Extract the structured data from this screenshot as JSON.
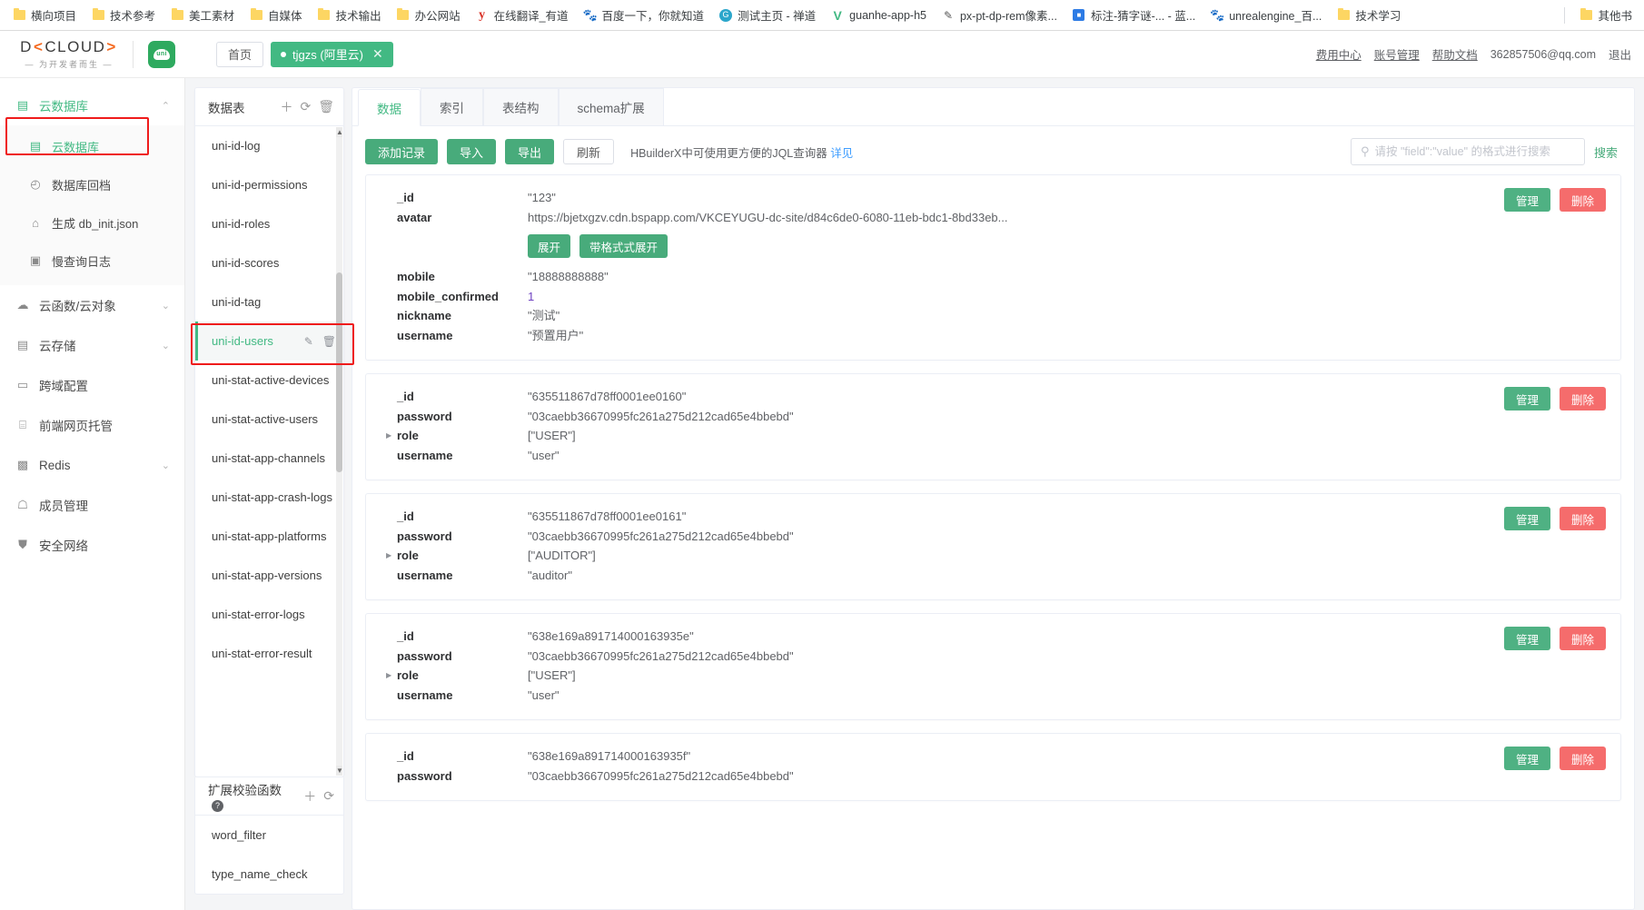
{
  "browser": {
    "bookmarks": [
      {
        "label": "横向项目",
        "icon": "folder-icon"
      },
      {
        "label": "技术参考",
        "icon": "folder-icon"
      },
      {
        "label": "美工素材",
        "icon": "folder-icon"
      },
      {
        "label": "自媒体",
        "icon": "folder-icon"
      },
      {
        "label": "技术输出",
        "icon": "folder-icon"
      },
      {
        "label": "办公网站",
        "icon": "folder-icon"
      },
      {
        "label": "在线翻译_有道",
        "icon": "youdao-icon"
      },
      {
        "label": "百度一下，你就知道",
        "icon": "baidu-icon"
      },
      {
        "label": "测试主页 - 禅道",
        "icon": "zentao-icon"
      },
      {
        "label": "guanhe-app-h5",
        "icon": "vue-icon"
      },
      {
        "label": "px-pt-dp-rem像素...",
        "icon": "px-icon"
      },
      {
        "label": "标注-猜字谜-... - 蓝...",
        "icon": "blue-doc-icon"
      },
      {
        "label": "unrealengine_百...",
        "icon": "baidu-icon"
      },
      {
        "label": "技术学习",
        "icon": "folder-icon"
      }
    ],
    "overflow": {
      "label": "其他书",
      "icon": "folder-icon"
    }
  },
  "header": {
    "logo_main": "DCLOUD",
    "logo_sub": "— 为开发者而生 —",
    "product_logo": "uni",
    "tabs": [
      {
        "label": "首页",
        "active": false
      },
      {
        "label": "tjgzs (阿里云)",
        "active": true,
        "closable": true
      }
    ],
    "links": [
      "费用中心",
      "账号管理",
      "帮助文档"
    ],
    "account": "362857506@qq.com",
    "logout": "退出"
  },
  "sidebar": {
    "groups": [
      {
        "label": "云数据库",
        "icon": "database-icon",
        "active": true,
        "expanded": true,
        "chevron": "chevron-up-icon",
        "items": [
          {
            "label": "云数据库",
            "icon": "database-icon",
            "current": true,
            "highlighted": true
          },
          {
            "label": "数据库回档",
            "icon": "history-icon",
            "current": false
          },
          {
            "label": "生成 db_init.json",
            "icon": "export-icon",
            "current": false
          },
          {
            "label": "慢查询日志",
            "icon": "log-icon",
            "current": false
          }
        ]
      },
      {
        "label": "云函数/云对象",
        "icon": "cloud-icon",
        "chevron": "chevron-down-icon"
      },
      {
        "label": "云存储",
        "icon": "storage-icon",
        "chevron": "chevron-down-icon"
      },
      {
        "label": "跨域配置",
        "icon": "cors-icon",
        "chevron": ""
      },
      {
        "label": "前端网页托管",
        "icon": "hosting-icon",
        "chevron": ""
      },
      {
        "label": "Redis",
        "icon": "redis-icon",
        "chevron": "chevron-down-icon"
      },
      {
        "label": "成员管理",
        "icon": "member-icon",
        "chevron": ""
      },
      {
        "label": "安全网络",
        "icon": "shield-icon",
        "chevron": ""
      }
    ]
  },
  "tablepanel": {
    "title": "数据表",
    "actions": [
      {
        "name": "add-table-icon",
        "glyph": "＋"
      },
      {
        "name": "refresh-tables-icon",
        "glyph": "⟳"
      },
      {
        "name": "delete-table-icon",
        "glyph": "🗑"
      }
    ],
    "tables": [
      {
        "name": "uni-id-log",
        "selected": false
      },
      {
        "name": "uni-id-permissions",
        "selected": false
      },
      {
        "name": "uni-id-roles",
        "selected": false
      },
      {
        "name": "uni-id-scores",
        "selected": false
      },
      {
        "name": "uni-id-tag",
        "selected": false
      },
      {
        "name": "uni-id-users",
        "selected": true,
        "highlighted": true
      },
      {
        "name": "uni-stat-active-devices",
        "selected": false
      },
      {
        "name": "uni-stat-active-users",
        "selected": false
      },
      {
        "name": "uni-stat-app-channels",
        "selected": false
      },
      {
        "name": "uni-stat-app-crash-logs",
        "selected": false
      },
      {
        "name": "uni-stat-app-platforms",
        "selected": false
      },
      {
        "name": "uni-stat-app-versions",
        "selected": false
      },
      {
        "name": "uni-stat-error-logs",
        "selected": false
      },
      {
        "name": "uni-stat-error-result",
        "selected": false
      }
    ],
    "row_edit_icon": "edit-icon",
    "row_delete_icon": "trash-icon",
    "extension": {
      "title": "扩展校验函数",
      "help_icon": "help-icon",
      "actions": [
        {
          "name": "add-function-icon",
          "glyph": "＋"
        },
        {
          "name": "refresh-functions-icon",
          "glyph": "⟳"
        }
      ],
      "items": [
        {
          "name": "word_filter"
        },
        {
          "name": "type_name_check"
        }
      ]
    }
  },
  "main": {
    "tabs": [
      {
        "label": "数据",
        "active": true
      },
      {
        "label": "索引",
        "active": false
      },
      {
        "label": "表结构",
        "active": false
      },
      {
        "label": "schema扩展",
        "active": false
      }
    ],
    "toolbar": {
      "add_record": "添加记录",
      "import": "导入",
      "export": "导出",
      "refresh": "刷新",
      "hint_prefix": "HBuilderX中可使用更方便的JQL查询器",
      "hint_link": "详见",
      "search_placeholder": "请按 \"field\":\"value\" 的格式进行搜索",
      "search_value": "",
      "search_button": "搜索",
      "search_icon": "search-icon"
    },
    "record_actions": {
      "manage": "管理",
      "delete": "删除"
    },
    "expand_buttons": {
      "expand": "展开",
      "formatted_expand": "带格式式展开"
    },
    "records": [
      {
        "fields": [
          {
            "key": "_id",
            "value": "\"123\"",
            "type": "str",
            "collapsible": false
          },
          {
            "key": "avatar",
            "value": "https://bjetxgzv.cdn.bspapp.com/VKCEYUGU-dc-site/d84c6de0-6080-11eb-bdc1-8bd33eb...",
            "type": "url",
            "collapsible": false,
            "has_expand_buttons": true
          },
          {
            "key": "mobile",
            "value": "\"18888888888\"",
            "type": "str",
            "collapsible": false
          },
          {
            "key": "mobile_confirmed",
            "value": "1",
            "type": "num",
            "collapsible": false
          },
          {
            "key": "nickname",
            "value": "\"测试\"",
            "type": "str",
            "collapsible": false
          },
          {
            "key": "username",
            "value": "\"预置用户\"",
            "type": "str",
            "collapsible": false
          }
        ]
      },
      {
        "fields": [
          {
            "key": "_id",
            "value": "\"635511867d78ff0001ee0160\"",
            "type": "str",
            "collapsible": false
          },
          {
            "key": "password",
            "value": "\"03caebb36670995fc261a275d212cad65e4bbebd\"",
            "type": "str",
            "collapsible": false
          },
          {
            "key": "role",
            "value": "[\"USER\"]",
            "type": "arr",
            "collapsible": true
          },
          {
            "key": "username",
            "value": "\"user\"",
            "type": "str",
            "collapsible": false
          }
        ]
      },
      {
        "fields": [
          {
            "key": "_id",
            "value": "\"635511867d78ff0001ee0161\"",
            "type": "str",
            "collapsible": false
          },
          {
            "key": "password",
            "value": "\"03caebb36670995fc261a275d212cad65e4bbebd\"",
            "type": "str",
            "collapsible": false
          },
          {
            "key": "role",
            "value": "[\"AUDITOR\"]",
            "type": "arr",
            "collapsible": true
          },
          {
            "key": "username",
            "value": "\"auditor\"",
            "type": "str",
            "collapsible": false
          }
        ]
      },
      {
        "fields": [
          {
            "key": "_id",
            "value": "\"638e169a891714000163935e\"",
            "type": "str",
            "collapsible": false
          },
          {
            "key": "password",
            "value": "\"03caebb36670995fc261a275d212cad65e4bbebd\"",
            "type": "str",
            "collapsible": false
          },
          {
            "key": "role",
            "value": "[\"USER\"]",
            "type": "arr",
            "collapsible": true
          },
          {
            "key": "username",
            "value": "\"user\"",
            "type": "str",
            "collapsible": false
          }
        ]
      },
      {
        "fields": [
          {
            "key": "_id",
            "value": "\"638e169a891714000163935f\"",
            "type": "str",
            "collapsible": false
          },
          {
            "key": "password",
            "value": "\"03caebb36670995fc261a275d212cad65e4bbebd\"",
            "type": "str",
            "collapsible": false
          }
        ]
      }
    ]
  },
  "colors": {
    "accent": "#42b983",
    "button_green": "#48ab7b",
    "danger": "#f56c6c",
    "highlight_box": "#ef1b1b",
    "link": "#409eff"
  }
}
